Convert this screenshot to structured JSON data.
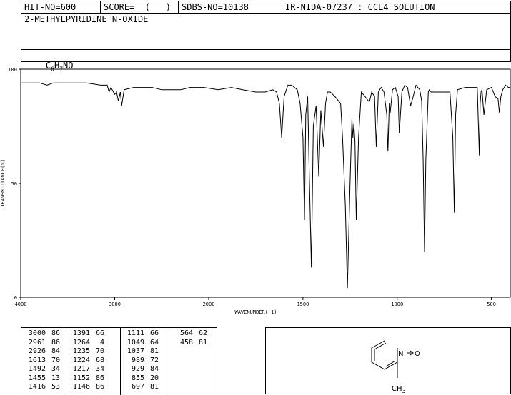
{
  "header": {
    "hit_no": "HIT-NO=600",
    "score": "SCORE=  (   )",
    "sdbs_no": "SDBS-NO=10138",
    "ir_id": "IR-NIDA-07237 : CCL4 SOLUTION",
    "compound_name": "2-METHYLPYRIDINE N-OXIDE",
    "formula_parts": [
      "C",
      "6",
      "H",
      "7",
      "NO"
    ]
  },
  "chart_data": {
    "type": "line",
    "title": "",
    "xlabel": "WAVENUMBER(-1)",
    "ylabel": "TRANSMITTANCE(%)",
    "xlim": [
      4000,
      400
    ],
    "ylim": [
      0,
      100
    ],
    "x_ticks": [
      "4000",
      "3000",
      "2000",
      "1500",
      "1000",
      "500"
    ],
    "y_ticks": [
      "0",
      "50",
      "100"
    ],
    "series": [
      {
        "name": "",
        "x": [
          4000,
          3800,
          3720,
          3650,
          3500,
          3300,
          3150,
          3080,
          3060,
          3040,
          3000,
          2980,
          2961,
          2940,
          2926,
          2900,
          2800,
          2600,
          2500,
          2300,
          2200,
          2050,
          1950,
          1880,
          1820,
          1750,
          1700,
          1660,
          1640,
          1625,
          1613,
          1600,
          1580,
          1560,
          1530,
          1515,
          1500,
          1492,
          1485,
          1475,
          1468,
          1455,
          1445,
          1430,
          1416,
          1405,
          1391,
          1380,
          1370,
          1355,
          1330,
          1300,
          1290,
          1275,
          1264,
          1250,
          1240,
          1235,
          1230,
          1224,
          1217,
          1205,
          1190,
          1170,
          1152,
          1146,
          1135,
          1120,
          1111,
          1100,
          1085,
          1070,
          1055,
          1049,
          1042,
          1037,
          1025,
          1010,
          995,
          989,
          975,
          960,
          945,
          929,
          915,
          900,
          880,
          870,
          862,
          855,
          848,
          835,
          830,
          820,
          720,
          705,
          697,
          690,
          680,
          640,
          600,
          575,
          564,
          560,
          555,
          550,
          540,
          525,
          500,
          480,
          465,
          458,
          450,
          440,
          425,
          410,
          400
        ],
        "y": [
          94,
          94,
          93,
          94,
          94,
          94,
          93,
          93,
          90,
          92,
          89,
          90,
          86,
          90,
          84,
          91,
          92,
          92,
          91,
          91,
          92,
          92,
          91,
          92,
          91,
          90,
          90,
          91,
          90,
          85,
          70,
          88,
          93,
          93,
          91,
          85,
          70,
          34,
          80,
          88,
          60,
          13,
          75,
          84,
          53,
          82,
          66,
          85,
          90,
          90,
          88,
          85,
          70,
          40,
          4,
          50,
          78,
          70,
          76,
          68,
          34,
          70,
          90,
          88,
          86,
          86,
          90,
          88,
          66,
          90,
          92,
          90,
          80,
          64,
          85,
          81,
          91,
          92,
          88,
          72,
          90,
          93,
          92,
          84,
          88,
          93,
          91,
          86,
          60,
          20,
          60,
          90,
          91,
          90,
          90,
          70,
          37,
          80,
          91,
          92,
          92,
          92,
          62,
          85,
          90,
          91,
          80,
          91,
          92,
          88,
          87,
          81,
          88,
          91,
          93,
          92,
          92
        ]
      }
    ]
  },
  "peak_table": [
    [
      [
        "3000",
        "86"
      ],
      [
        "2961",
        "86"
      ],
      [
        "2926",
        "84"
      ],
      [
        "1613",
        "70"
      ],
      [
        "1492",
        "34"
      ],
      [
        "1455",
        "13"
      ],
      [
        "1416",
        "53"
      ]
    ],
    [
      [
        "1391",
        "66"
      ],
      [
        "1264",
        "4"
      ],
      [
        "1235",
        "70"
      ],
      [
        "1224",
        "68"
      ],
      [
        "1217",
        "34"
      ],
      [
        "1152",
        "86"
      ],
      [
        "1146",
        "86"
      ]
    ],
    [
      [
        "1111",
        "66"
      ],
      [
        "1049",
        "64"
      ],
      [
        "1037",
        "81"
      ],
      [
        "989",
        "72"
      ],
      [
        "929",
        "84"
      ],
      [
        "855",
        "20"
      ],
      [
        "697",
        "81"
      ]
    ],
    [
      [
        "564",
        "62"
      ],
      [
        "458",
        "81"
      ]
    ]
  ],
  "structure": {
    "n_label": "N",
    "o_label": "O",
    "ch3_label": "CH",
    "ch3_sub": "3"
  }
}
